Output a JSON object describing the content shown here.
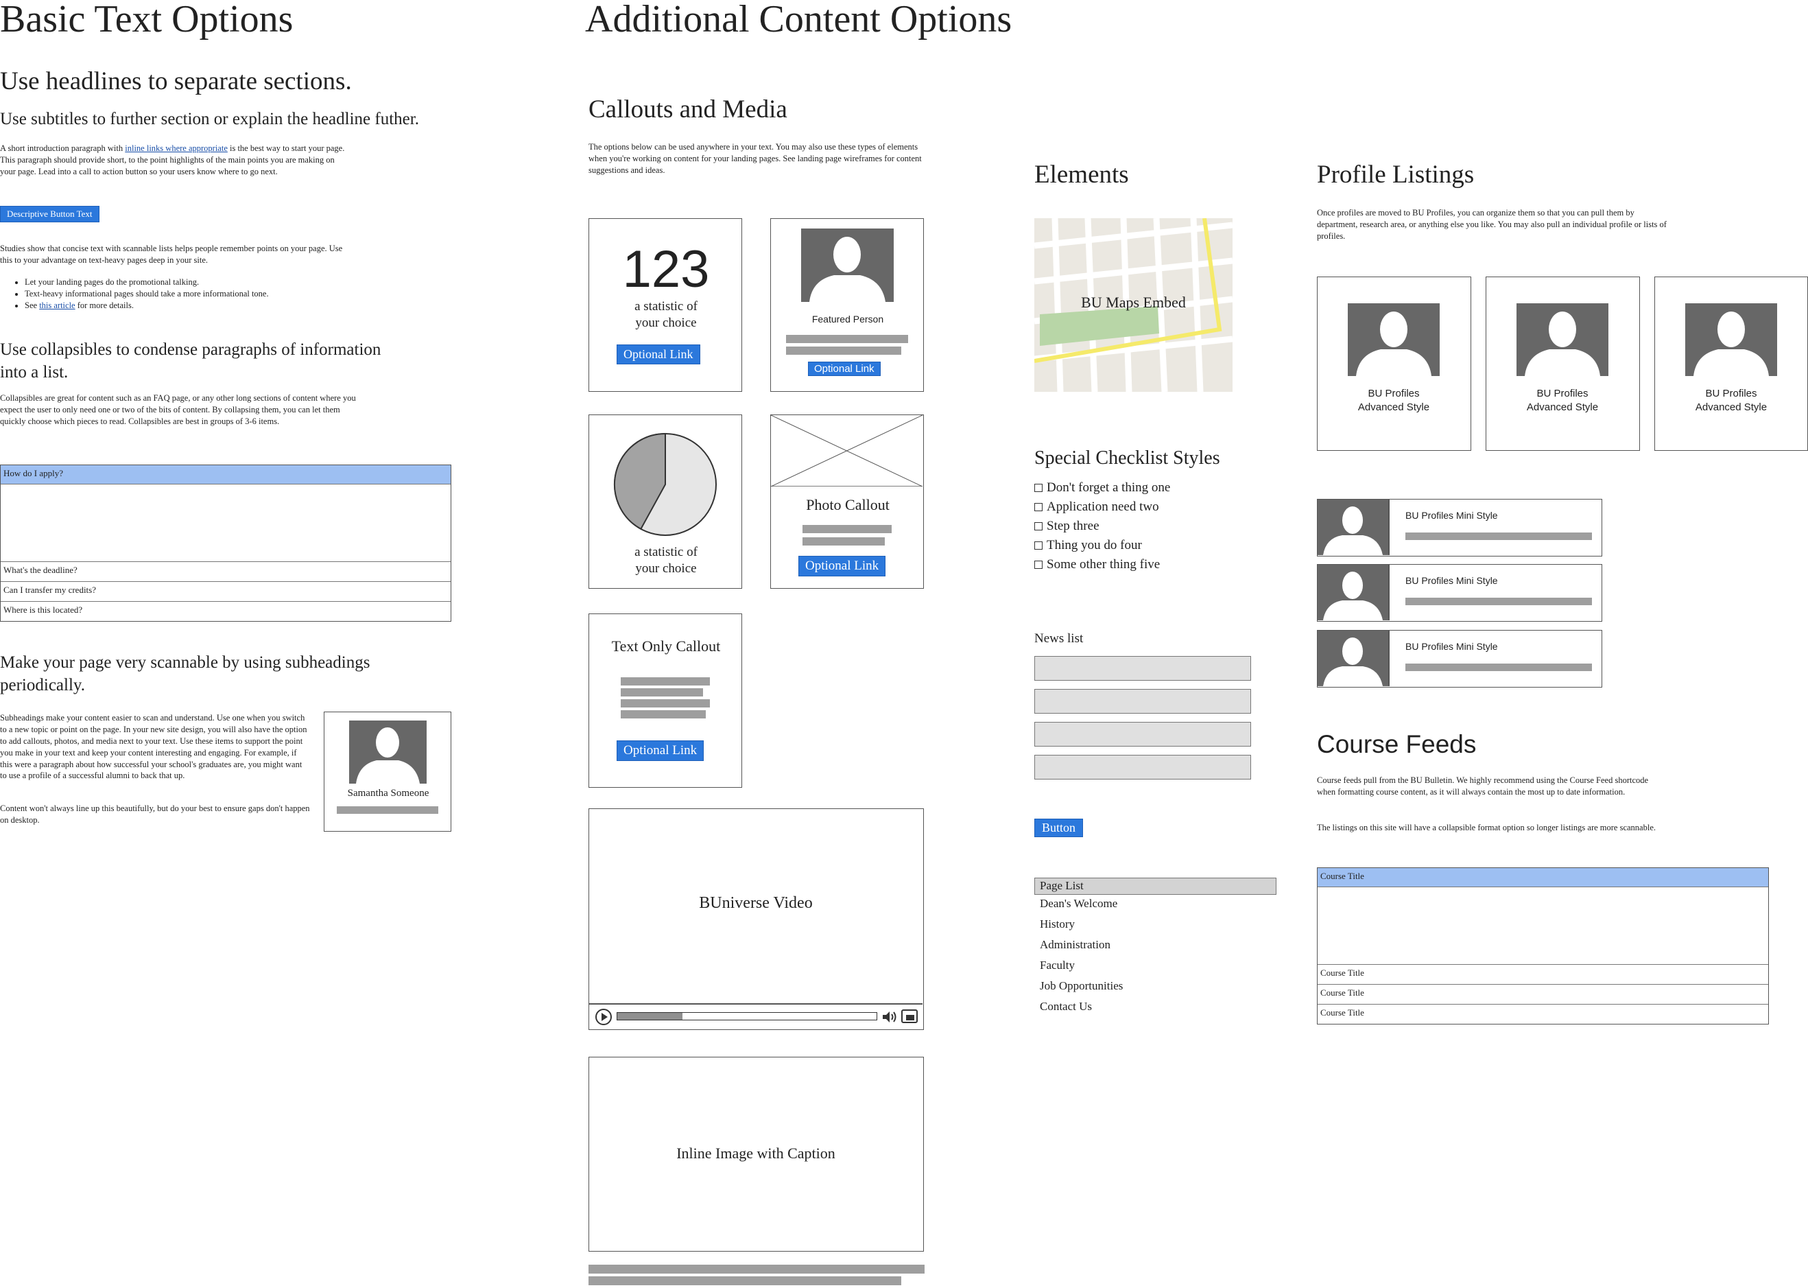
{
  "left": {
    "title": "Basic Text Options",
    "headline1": "Use headlines to separate sections.",
    "subtitle1": "Use subtitles to further section or explain the headline futher.",
    "intro_prefix": "A short introduction paragraph with ",
    "intro_link": "inline links where appropriate",
    "intro_suffix": " is the best way to start your page. This paragraph should provide short, to the point highlights of the main points you are making on your page. Lead into a call to action button so your users know where to go next.",
    "button_label": "Descriptive Button Text",
    "studies_text": "Studies show that concise text with scannable lists helps people remember points on your page. Use this to your advantage on text-heavy pages deep in your site.",
    "list_item_1": "Let your landing pages do the promotional talking.",
    "list_item_2": "Text-heavy informational pages should take a more informational tone.",
    "list_item_3_prefix": "See ",
    "list_item_3_link": "this article",
    "list_item_3_suffix": " for more details.",
    "headline2": "Use collapsibles to condense paragraphs of information into a list.",
    "collapsibles_text": "Collapsibles are great for content such as an FAQ page, or any other long sections of content where you expect the user to only need one or two of the bits of content. By collapsing them, you can let them quickly choose which pieces to read. Collapsibles are best in groups of 3-6 items.",
    "accordion": {
      "open_item": "How do I apply?",
      "items": [
        "What's the deadline?",
        "Can I transfer my credits?",
        "Where is this located?"
      ]
    },
    "headline3": "Make your page very scannable by using subheadings periodically.",
    "subheadings_text": "Subheadings make your content easier to scan and understand. Use one when you switch to a new topic or point on the page. In your new site design, you will also have the option to add callouts, photos, and media next to your text. Use these items to support the point you make in your text and keep your content interesting and engaging. For example, if this were a paragraph about how successful your school's graduates are, you might want to use a profile of a successful alumni to back that up.",
    "content_note": "Content won't always line up this beautifully, but do your best to ensure gaps don't happen on desktop.",
    "profile_name": "Samantha Someone"
  },
  "middle": {
    "title": "Additional Content Options",
    "section_title": "Callouts and Media",
    "section_text": "The options below can be used anywhere in your text. You may also use these types of elements when you're working on content for your landing pages. See landing page wireframes for content suggestions and ideas.",
    "stat_number": "123",
    "stat_caption": "a statistic of your choice",
    "optional_link": "Optional Link",
    "featured_person": "Featured Person",
    "pie_caption": "a statistic of your choice",
    "pie_value": 0.42,
    "photo_callout": "Photo Callout",
    "text_callout": "Text Only Callout",
    "video_title": "BUniverse Video",
    "video_progress": 0.25,
    "inline_image": "Inline Image with Caption"
  },
  "elements": {
    "title": "Elements",
    "map_label": "BU Maps Embed",
    "checklist_title": "Special Checklist Styles",
    "checklist": [
      "Don't forget a thing one",
      "Application need two",
      "Step three",
      "Thing you do four",
      "Some other thing five"
    ],
    "news_title": "News list",
    "button_label": "Button",
    "page_list_title": "Page List",
    "page_list": [
      "Dean's Welcome",
      "History",
      "Administration",
      "Faculty",
      "Job Opportunities",
      "Contact Us"
    ]
  },
  "profiles": {
    "title": "Profile Listings",
    "text": "Once profiles are moved to BU Profiles, you can organize them so that you can pull them by department, research area, or anything else you like. You may also pull an individual profile or lists of profiles.",
    "advanced_label": "BU Profiles Advanced Style",
    "mini_label": "BU Profiles Mini Style",
    "course_title": "Course Feeds",
    "course_text_1": "Course feeds pull from the BU Bulletin. We highly recommend using the Course Feed shortcode when formatting course content, as it will always contain the most up to date information.",
    "course_text_2": "The listings on this site will have a collapsible format option so longer listings are more scannable.",
    "course_item": "Course Title"
  }
}
